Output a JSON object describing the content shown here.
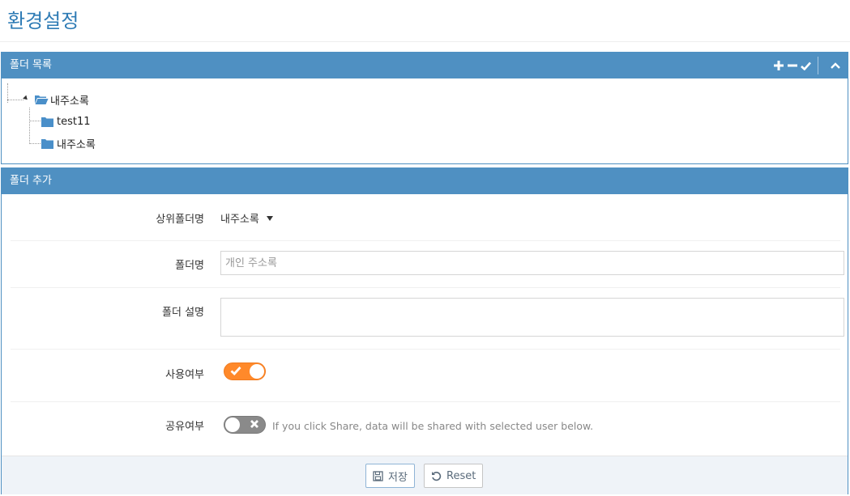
{
  "page": {
    "title": "환경설정"
  },
  "folder_list": {
    "header": "폴더 목록",
    "tree": {
      "root": {
        "label": "내주소록"
      },
      "children": [
        {
          "label": "test11"
        },
        {
          "label": "내주소록"
        }
      ]
    }
  },
  "folder_add": {
    "header": "폴더 추가",
    "parent_folder": {
      "label": "상위폴더명",
      "value": "내주소록"
    },
    "folder_name": {
      "label": "폴더명",
      "value": "",
      "placeholder": "개인 주소록"
    },
    "folder_desc": {
      "label": "폴더 설명",
      "value": ""
    },
    "use": {
      "label": "사용여부",
      "on": true
    },
    "share": {
      "label": "공유여부",
      "on": false,
      "hint": "If you click Share, data will be shared with selected user below."
    },
    "actions": {
      "save_label": "저장",
      "reset_label": "Reset"
    }
  },
  "colors": {
    "header_blue": "#4f90c2",
    "title_blue": "#2e7bb5",
    "toggle_on": "#ff892a",
    "toggle_off": "#8a8a8a",
    "folder_icon": "#4a8fc9"
  },
  "icons": {
    "toolbar": [
      "plus-icon",
      "minus-icon",
      "check-icon",
      "chevron-up-icon"
    ],
    "tree": [
      "folder-open-icon",
      "folder-icon"
    ],
    "buttons": [
      "save-icon",
      "undo-icon"
    ]
  }
}
